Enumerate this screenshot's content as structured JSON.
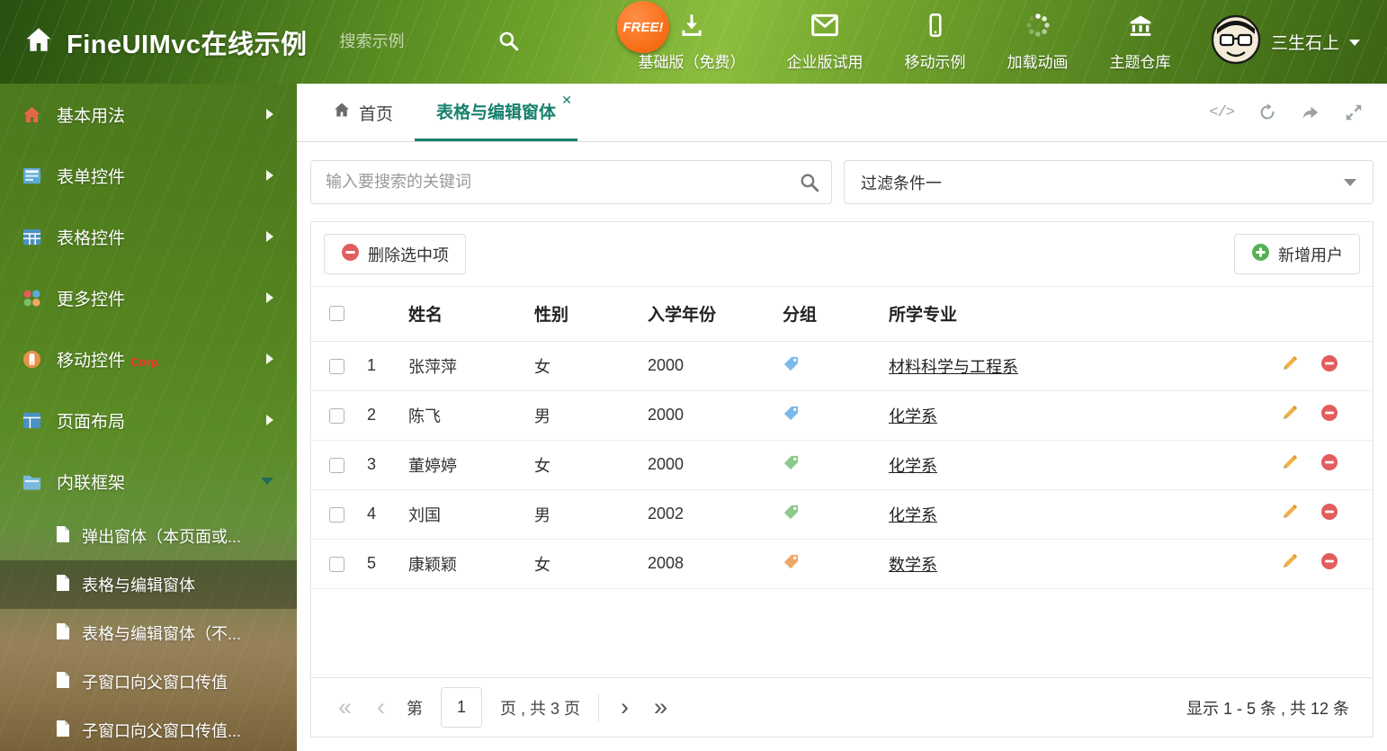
{
  "header": {
    "title": "FineUIMvc在线示例",
    "search_placeholder": "搜索示例",
    "free_badge": "FREE!",
    "nav": [
      {
        "label": "基础版（免费）",
        "icon": "download-icon"
      },
      {
        "label": "企业版试用",
        "icon": "mail-icon"
      },
      {
        "label": "移动示例",
        "icon": "mobile-icon"
      },
      {
        "label": "加载动画",
        "icon": "spinner-icon"
      },
      {
        "label": "主题仓库",
        "icon": "bank-icon"
      }
    ],
    "username": "三生石上"
  },
  "sidebar": {
    "items": [
      {
        "label": "基本用法",
        "icon": "home-icon"
      },
      {
        "label": "表单控件",
        "icon": "form-icon"
      },
      {
        "label": "表格控件",
        "icon": "table-icon"
      },
      {
        "label": "更多控件",
        "icon": "widgets-icon"
      },
      {
        "label": "移动控件",
        "icon": "mobile-icon",
        "badge": "Corp."
      },
      {
        "label": "页面布局",
        "icon": "layout-icon"
      },
      {
        "label": "内联框架",
        "icon": "frame-icon",
        "expanded": true
      }
    ],
    "subitems": [
      {
        "label": "弹出窗体（本页面或..."
      },
      {
        "label": "表格与编辑窗体",
        "active": true
      },
      {
        "label": "表格与编辑窗体（不..."
      },
      {
        "label": "子窗口向父窗口传值"
      },
      {
        "label": "子窗口向父窗口传值..."
      }
    ]
  },
  "tabbar": {
    "home_tab": "首页",
    "active_tab": "表格与编辑窗体",
    "code_glyph": "</>"
  },
  "filters": {
    "search_placeholder": "输入要搜索的关键词",
    "filter_selected": "过滤条件一"
  },
  "toolbar": {
    "delete_label": "删除选中项",
    "add_label": "新增用户"
  },
  "table": {
    "columns": {
      "name": "姓名",
      "gender": "性别",
      "year": "入学年份",
      "group": "分组",
      "major": "所学专业"
    },
    "rows": [
      {
        "index": "1",
        "name": "张萍萍",
        "gender": "女",
        "year": "2000",
        "tag_color": "#7db9e8",
        "major": "材料科学与工程系"
      },
      {
        "index": "2",
        "name": "陈飞",
        "gender": "男",
        "year": "2000",
        "tag_color": "#7db9e8",
        "major": "化学系"
      },
      {
        "index": "3",
        "name": "董婷婷",
        "gender": "女",
        "year": "2000",
        "tag_color": "#8cc98c",
        "major": "化学系"
      },
      {
        "index": "4",
        "name": "刘国",
        "gender": "男",
        "year": "2002",
        "tag_color": "#8cc98c",
        "major": "化学系"
      },
      {
        "index": "5",
        "name": "康颖颖",
        "gender": "女",
        "year": "2008",
        "tag_color": "#f2a76a",
        "major": "数学系"
      }
    ]
  },
  "pagination": {
    "page_prefix": "第",
    "page_value": "1",
    "page_suffix": "页 , 共 3 页",
    "summary": "显示 1 - 5 条 , 共 12 条"
  },
  "colors": {
    "accent": "#18806e",
    "danger": "#e25d5d",
    "success": "#55b055",
    "pencil": "#f0b149"
  }
}
